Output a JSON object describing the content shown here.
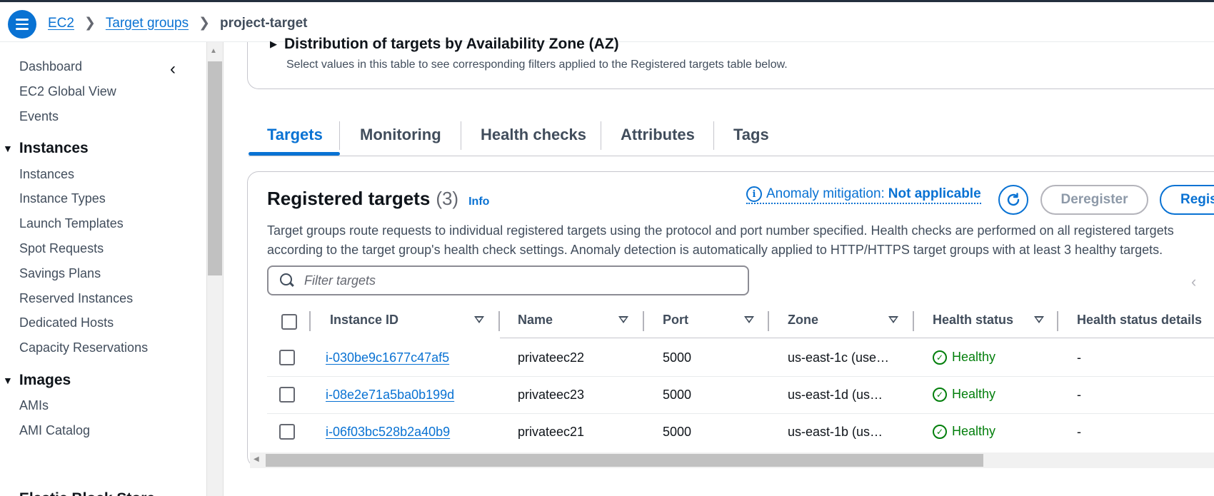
{
  "breadcrumb": {
    "items": [
      "EC2",
      "Target groups"
    ],
    "current": "project-target"
  },
  "sidebar": {
    "top_items": [
      "Dashboard",
      "EC2 Global View",
      "Events"
    ],
    "sections": [
      {
        "heading": "Instances",
        "items": [
          "Instances",
          "Instance Types",
          "Launch Templates",
          "Spot Requests",
          "Savings Plans",
          "Reserved Instances",
          "Dedicated Hosts",
          "Capacity Reservations"
        ]
      },
      {
        "heading": "Images",
        "items": [
          "AMIs",
          "AMI Catalog"
        ]
      }
    ],
    "partial_heading": "Elastic Block Store"
  },
  "az_section": {
    "title": "Distribution of targets by Availability Zone (AZ)",
    "description": "Select values in this table to see corresponding filters applied to the Registered targets table below."
  },
  "tabs": [
    "Targets",
    "Monitoring",
    "Health checks",
    "Attributes",
    "Tags"
  ],
  "active_tab": "Targets",
  "registered_targets": {
    "title": "Registered targets",
    "count": "(3)",
    "info_label": "Info",
    "anomaly_label": "Anomaly mitigation:",
    "anomaly_value": "Not applicable",
    "deregister_label": "Deregister",
    "register_label": "Register targets",
    "description_line1": "Target groups route requests to individual registered targets using the protocol and port number specified. Health checks are performed on all registered targets",
    "description_line2": "according to the target group's health check settings. Anomaly detection is automatically applied to HTTP/HTTPS target groups with at least 3 healthy targets.",
    "filter_placeholder": "Filter targets",
    "columns": [
      "Instance ID",
      "Name",
      "Port",
      "Zone",
      "Health status",
      "Health status details"
    ],
    "rows": [
      {
        "instance_id": "i-030be9c1677c47af5",
        "name": "privateec22",
        "port": "5000",
        "zone": "us-east-1c (use…",
        "health": "Healthy",
        "details": "-"
      },
      {
        "instance_id": "i-08e2e71a5ba0b199d",
        "name": "privateec23",
        "port": "5000",
        "zone": "us-east-1d (us…",
        "health": "Healthy",
        "details": "-"
      },
      {
        "instance_id": "i-06f03bc528b2a40b9",
        "name": "privateec21",
        "port": "5000",
        "zone": "us-east-1b (us…",
        "health": "Healthy",
        "details": "-"
      }
    ]
  },
  "colors": {
    "accent": "#0972d3",
    "healthy": "#037f0c",
    "text": "#0f141a",
    "muted": "#414d5c"
  }
}
